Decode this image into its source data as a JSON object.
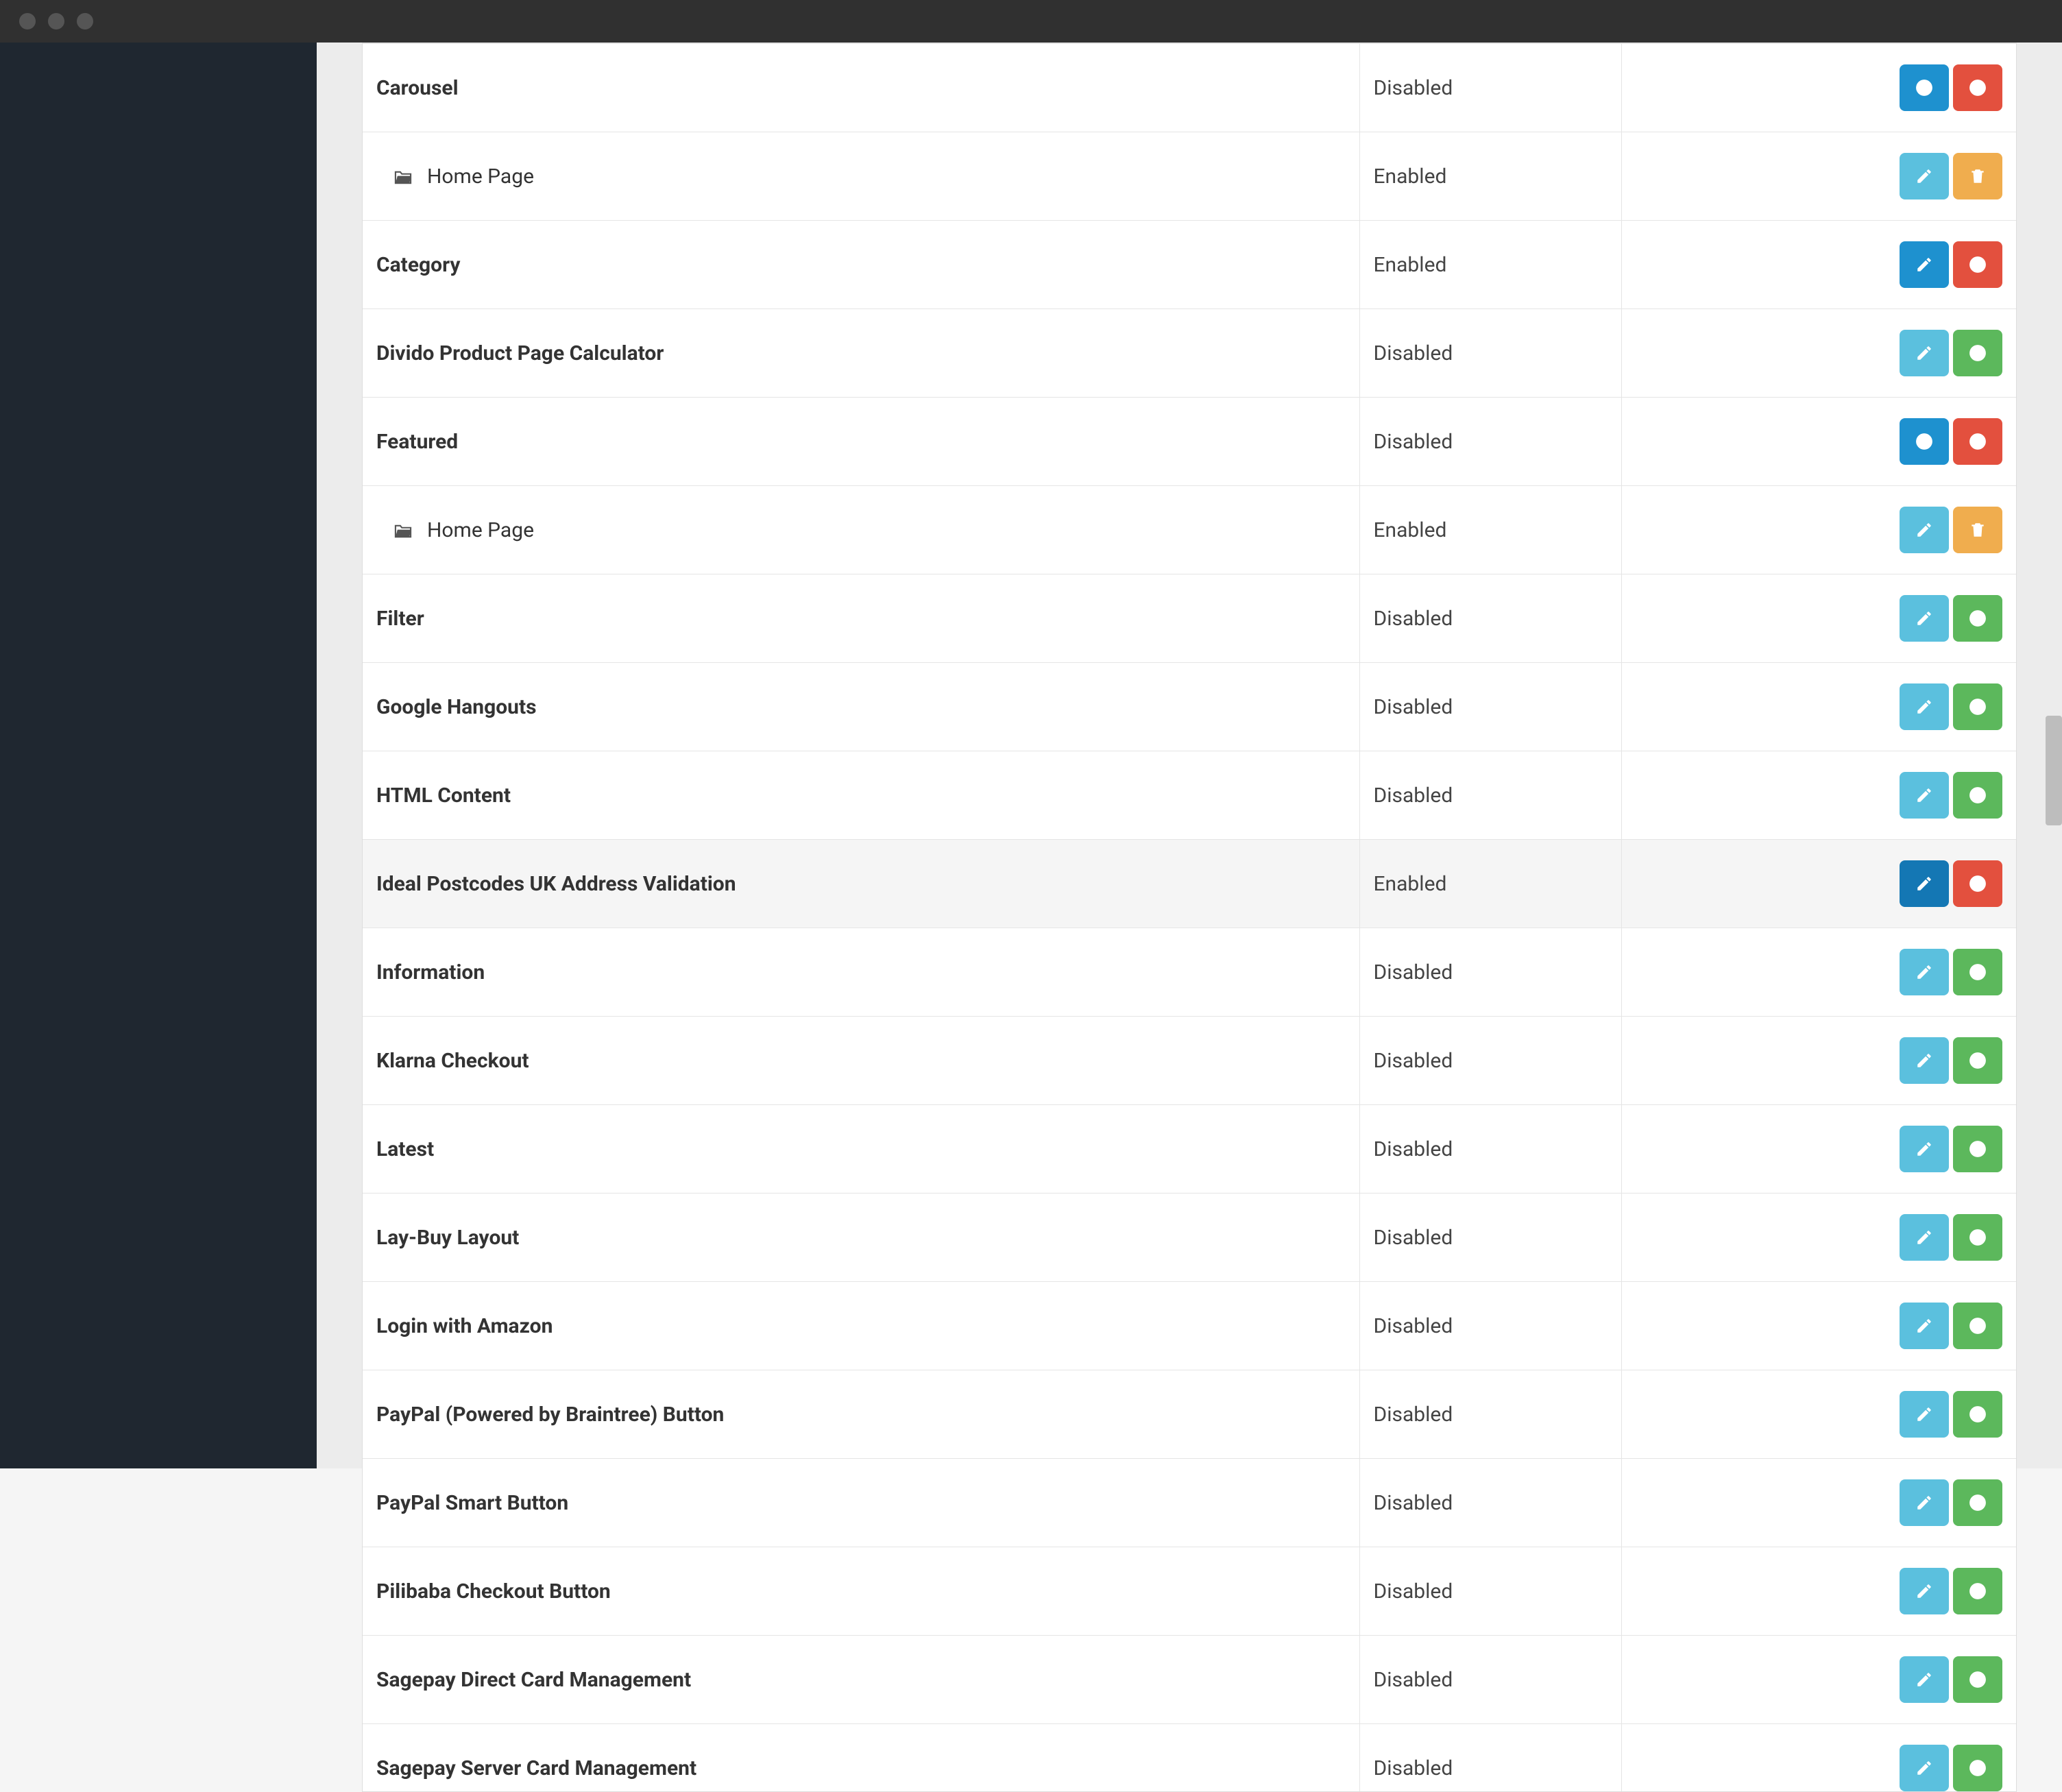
{
  "colors": {
    "sidebar": "#1f2730",
    "content_bg": "#ececec",
    "btn_blue": "#1e91cf",
    "btn_light": "#5bc0de",
    "btn_green": "#5cb85c",
    "btn_red": "#e3503e",
    "btn_orange": "#f0ad4e"
  },
  "status_labels": {
    "enabled": "Enabled",
    "disabled": "Disabled"
  },
  "rows": [
    {
      "name": "Carousel",
      "status": "Disabled",
      "primary_action": "add",
      "secondary_action": "remove",
      "sub": false
    },
    {
      "name": "Home Page",
      "status": "Enabled",
      "primary_action": "edit-light",
      "secondary_action": "delete",
      "sub": true
    },
    {
      "name": "Category",
      "status": "Enabled",
      "primary_action": "edit",
      "secondary_action": "remove",
      "sub": false
    },
    {
      "name": "Divido Product Page Calculator",
      "status": "Disabled",
      "primary_action": "edit-light",
      "secondary_action": "install",
      "sub": false
    },
    {
      "name": "Featured",
      "status": "Disabled",
      "primary_action": "add",
      "secondary_action": "remove",
      "sub": false
    },
    {
      "name": "Home Page",
      "status": "Enabled",
      "primary_action": "edit-light",
      "secondary_action": "delete",
      "sub": true
    },
    {
      "name": "Filter",
      "status": "Disabled",
      "primary_action": "edit-light",
      "secondary_action": "install",
      "sub": false
    },
    {
      "name": "Google Hangouts",
      "status": "Disabled",
      "primary_action": "edit-light",
      "secondary_action": "install",
      "sub": false
    },
    {
      "name": "HTML Content",
      "status": "Disabled",
      "primary_action": "edit-light",
      "secondary_action": "install",
      "sub": false
    },
    {
      "name": "Ideal Postcodes UK Address Validation",
      "status": "Enabled",
      "primary_action": "edit-dark",
      "secondary_action": "remove",
      "sub": false,
      "highlight": true
    },
    {
      "name": "Information",
      "status": "Disabled",
      "primary_action": "edit-light",
      "secondary_action": "install",
      "sub": false
    },
    {
      "name": "Klarna Checkout",
      "status": "Disabled",
      "primary_action": "edit-light",
      "secondary_action": "install",
      "sub": false
    },
    {
      "name": "Latest",
      "status": "Disabled",
      "primary_action": "edit-light",
      "secondary_action": "install",
      "sub": false
    },
    {
      "name": "Lay-Buy Layout",
      "status": "Disabled",
      "primary_action": "edit-light",
      "secondary_action": "install",
      "sub": false
    },
    {
      "name": "Login with Amazon",
      "status": "Disabled",
      "primary_action": "edit-light",
      "secondary_action": "install",
      "sub": false
    },
    {
      "name": "PayPal (Powered by Braintree) Button",
      "status": "Disabled",
      "primary_action": "edit-light",
      "secondary_action": "install",
      "sub": false
    },
    {
      "name": "PayPal Smart Button",
      "status": "Disabled",
      "primary_action": "edit-light",
      "secondary_action": "install",
      "sub": false
    },
    {
      "name": "Pilibaba Checkout Button",
      "status": "Disabled",
      "primary_action": "edit-light",
      "secondary_action": "install",
      "sub": false
    },
    {
      "name": "Sagepay Direct Card Management",
      "status": "Disabled",
      "primary_action": "edit-light",
      "secondary_action": "install",
      "sub": false
    },
    {
      "name": "Sagepay Server Card Management",
      "status": "Disabled",
      "primary_action": "edit-light",
      "secondary_action": "install",
      "sub": false,
      "partial_bottom": true
    }
  ]
}
